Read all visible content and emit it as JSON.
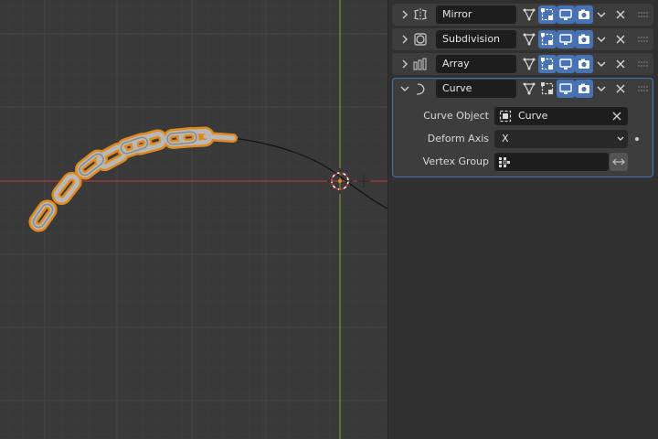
{
  "viewport": {
    "axis_colors": {
      "x_axis": "#a63a3a",
      "y_axis": "#7a9a35",
      "curve": "#111111",
      "selection_outline": "#e08a1e"
    }
  },
  "modifiers": [
    {
      "name": "Mirror",
      "icon": "mirror-modifier-icon",
      "expanded": false,
      "toggles": [
        "edit-mode-cage-icon",
        "edit-mode-icon",
        "realtime-display-icon",
        "render-camera-icon"
      ]
    },
    {
      "name": "Subdivision",
      "icon": "subdivision-modifier-icon",
      "expanded": false,
      "toggles": [
        "edit-mode-cage-icon",
        "edit-mode-icon",
        "realtime-display-icon",
        "render-camera-icon"
      ]
    },
    {
      "name": "Array",
      "icon": "array-modifier-icon",
      "expanded": false,
      "toggles": [
        "edit-mode-cage-icon",
        "edit-mode-icon",
        "realtime-display-icon",
        "render-camera-icon"
      ]
    },
    {
      "name": "Curve",
      "icon": "curve-modifier-icon",
      "expanded": true,
      "toggles": [
        "edit-mode-cage-icon",
        "edit-mode-icon",
        "realtime-display-icon",
        "render-camera-icon"
      ],
      "properties": {
        "curve_object_label": "Curve Object",
        "curve_object_value": "Curve",
        "deform_axis_label": "Deform Axis",
        "deform_axis_value": "X",
        "vertex_group_label": "Vertex Group",
        "vertex_group_value": ""
      }
    }
  ],
  "colors": {
    "accent": "#4772b3",
    "panel_bg": "#303030",
    "field_bg": "#1d1d1d"
  }
}
